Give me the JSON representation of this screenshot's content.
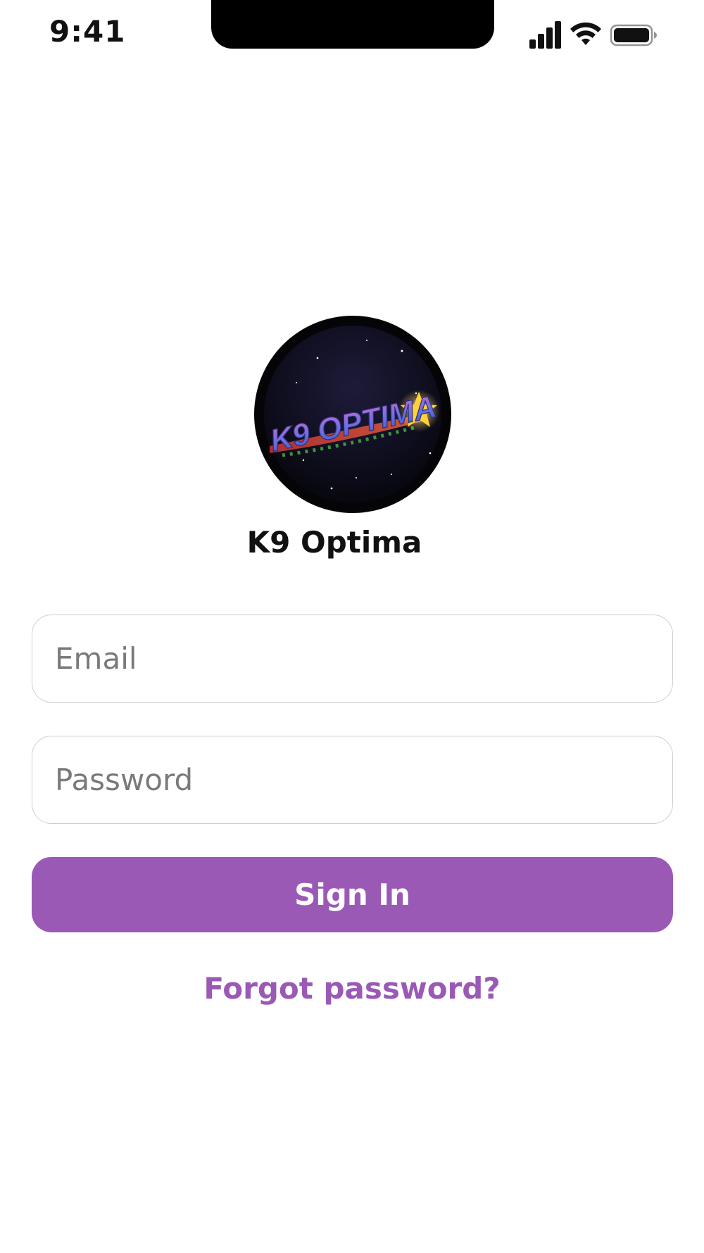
{
  "status_bar": {
    "time": "9:41",
    "icons": [
      "cellular-signal-icon",
      "wifi-icon",
      "battery-icon"
    ]
  },
  "logo": {
    "text": "K9 OPTIMA"
  },
  "brand": {
    "name": "K9 Optima"
  },
  "form": {
    "email": {
      "placeholder": "Email",
      "value": ""
    },
    "password": {
      "placeholder": "Password",
      "value": ""
    },
    "sign_in_label": "Sign In",
    "forgot_password_label": "Forgot password?"
  },
  "colors": {
    "accent": "#9B59B6",
    "button_text": "#FFFFFF",
    "placeholder": "#7A7A7A",
    "field_border": "#CFCFCF",
    "logo_background": "#0E0D1C"
  }
}
